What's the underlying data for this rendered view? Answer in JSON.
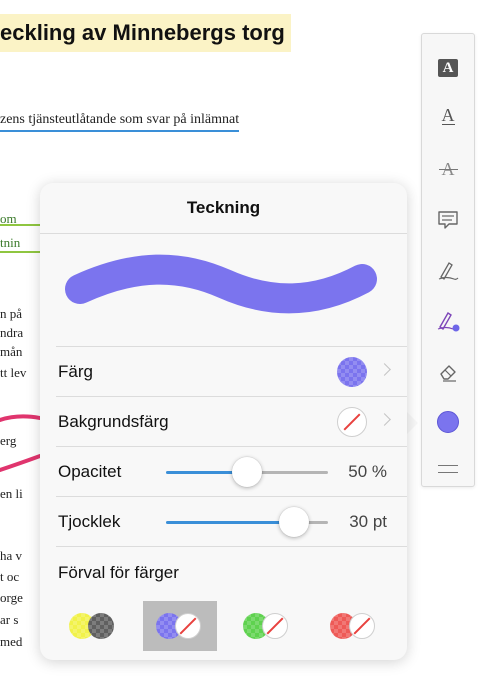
{
  "document": {
    "title": "eckling av Minnebergs torg",
    "line1": "zens tjänsteutlåtande som svar på inlämnat",
    "fragments": [
      "om",
      "tnin",
      "n på",
      "ndra",
      "mån",
      "tt lev",
      "erg",
      "en li",
      "ha v",
      "t oc",
      "orge",
      "ar s",
      "med"
    ]
  },
  "toolbar": {
    "items": [
      {
        "name": "text-box-tool",
        "icon": "text-box-icon",
        "glyph": "A"
      },
      {
        "name": "underline-tool",
        "icon": "underline-icon",
        "glyph": "A"
      },
      {
        "name": "strikethrough-tool",
        "icon": "strikethrough-icon",
        "glyph": "A"
      },
      {
        "name": "comment-tool",
        "icon": "comment-icon"
      },
      {
        "name": "signature-tool",
        "icon": "signature-icon"
      },
      {
        "name": "drawing-tool",
        "icon": "drawing-pen-icon"
      },
      {
        "name": "eraser-tool",
        "icon": "eraser-icon"
      },
      {
        "name": "color-tool",
        "icon": "color-dot-icon"
      },
      {
        "name": "menu-tool",
        "icon": "lines-icon"
      }
    ]
  },
  "popover": {
    "title": "Teckning",
    "color_label": "Färg",
    "color_value": "#7b74ee",
    "background_label": "Bakgrundsfärg",
    "opacity_label": "Opacitet",
    "opacity_value": "50 %",
    "opacity_fraction": 0.5,
    "thickness_label": "Tjocklek",
    "thickness_value": "30 pt",
    "thickness_fraction": 0.79,
    "presets_label": "Förval för färger",
    "presets": [
      {
        "name": "yellow-gray",
        "primary": "#f1f24a",
        "secondary": "#606060",
        "selected": false
      },
      {
        "name": "blue-none",
        "primary": "#7b74ee",
        "secondary": "none",
        "selected": true
      },
      {
        "name": "green-none",
        "primary": "#5fd24f",
        "secondary": "none",
        "selected": false
      },
      {
        "name": "red-none",
        "primary": "#ee5a57",
        "secondary": "none",
        "selected": false
      }
    ]
  },
  "colors": {
    "accent": "#3a8fd8",
    "stroke": "#7b74ee",
    "ink_red": "#e0356e"
  }
}
